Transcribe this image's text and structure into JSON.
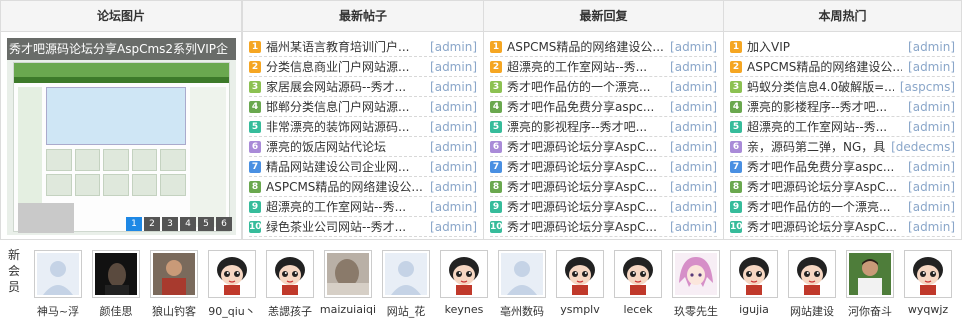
{
  "panels": {
    "pics": {
      "title": "论坛图片"
    },
    "posts": {
      "title": "最新帖子"
    },
    "replies": {
      "title": "最新回复"
    },
    "hot": {
      "title": "本周热门"
    }
  },
  "slide": {
    "caption": "秀才吧源码论坛分享AspCms2系列VIP企",
    "pages": [
      "1",
      "2",
      "3",
      "4",
      "5",
      "6"
    ],
    "active_page": 1
  },
  "latest_posts": [
    {
      "num": "1",
      "title": "福州某语言教育培训门户...",
      "author": "[admin]"
    },
    {
      "num": "2",
      "title": "分类信息商业门户网站源...",
      "author": "[admin]"
    },
    {
      "num": "3",
      "title": "家居展会网站源码--秀才...",
      "author": "[admin]"
    },
    {
      "num": "4",
      "title": "邯郸分类信息门户网站源...",
      "author": "[admin]"
    },
    {
      "num": "5",
      "title": "非常漂亮的装饰网站源码...",
      "author": "[admin]"
    },
    {
      "num": "6",
      "title": "漂亮的饭店网站代论坛",
      "author": "[admin]"
    },
    {
      "num": "7",
      "title": "精品网站建设公司企业网...",
      "author": "[admin]"
    },
    {
      "num": "8",
      "title": "ASPCMS精品的网络建设公...",
      "author": "[admin]"
    },
    {
      "num": "9",
      "title": "超漂亮的工作室网站--秀...",
      "author": "[admin]"
    },
    {
      "num": "10",
      "title": "绿色茶业公司网站--秀才...",
      "author": "[admin]"
    }
  ],
  "latest_replies": [
    {
      "num": "1",
      "title": "ASPCMS精品的网络建设公...",
      "author": "[admin]"
    },
    {
      "num": "2",
      "title": "超漂亮的工作室网站--秀...",
      "author": "[admin]"
    },
    {
      "num": "3",
      "title": "秀才吧作品仿的一个漂亮...",
      "author": "[admin]"
    },
    {
      "num": "4",
      "title": "秀才吧作品免费分享aspc...",
      "author": "[admin]"
    },
    {
      "num": "5",
      "title": "漂亮的影视程序--秀才吧...",
      "author": "[admin]"
    },
    {
      "num": "6",
      "title": "秀才吧源码论坛分享AspC...",
      "author": "[admin]"
    },
    {
      "num": "7",
      "title": "秀才吧源码论坛分享AspC...",
      "author": "[admin]"
    },
    {
      "num": "8",
      "title": "秀才吧源码论坛分享AspC...",
      "author": "[admin]"
    },
    {
      "num": "9",
      "title": "秀才吧源码论坛分享AspC...",
      "author": "[admin]"
    },
    {
      "num": "10",
      "title": "秀才吧源码论坛分享AspC...",
      "author": "[admin]"
    }
  ],
  "weekly_hot": [
    {
      "num": "1",
      "title": "加入VIP",
      "author": "[admin]"
    },
    {
      "num": "2",
      "title": "ASPCMS精品的网络建设公...",
      "author": "[admin]"
    },
    {
      "num": "3",
      "title": "蚂蚁分类信息4.0破解版=...",
      "author": "[aspcms]"
    },
    {
      "num": "4",
      "title": "漂亮的影楼程序--秀才吧...",
      "author": "[admin]"
    },
    {
      "num": "5",
      "title": "超漂亮的工作室网站--秀...",
      "author": "[admin]"
    },
    {
      "num": "6",
      "title": "亲，源码第二弹，NG，具...",
      "author": "[dedecms]"
    },
    {
      "num": "7",
      "title": "秀才吧作品免费分享aspc...",
      "author": "[admin]"
    },
    {
      "num": "8",
      "title": "秀才吧源码论坛分享AspC...",
      "author": "[admin]"
    },
    {
      "num": "9",
      "title": "秀才吧作品仿的一个漂亮...",
      "author": "[admin]"
    },
    {
      "num": "10",
      "title": "秀才吧源码论坛分享AspC...",
      "author": "[admin]"
    }
  ],
  "members": {
    "label": "新会员",
    "list": [
      {
        "name": "神马~浮",
        "avatar": "default"
      },
      {
        "name": "颜佳思",
        "avatar": "dark-photo"
      },
      {
        "name": "狼山钓客",
        "avatar": "person-photo"
      },
      {
        "name": "90_qiu丶",
        "avatar": "cartoon"
      },
      {
        "name": "恙諰孩子",
        "avatar": "cartoon"
      },
      {
        "name": "maizuiaiqi",
        "avatar": "blur-photo"
      },
      {
        "name": "网站_花",
        "avatar": "default"
      },
      {
        "name": "keynes",
        "avatar": "cartoon"
      },
      {
        "name": "亳州数码",
        "avatar": "default"
      },
      {
        "name": "ysmplv",
        "avatar": "cartoon"
      },
      {
        "name": "lecek",
        "avatar": "cartoon"
      },
      {
        "name": "玖零先生",
        "avatar": "anime"
      },
      {
        "name": "igujia",
        "avatar": "cartoon"
      },
      {
        "name": "网站建设",
        "avatar": "cartoon"
      },
      {
        "name": "河你奋斗",
        "avatar": "sport-photo"
      },
      {
        "name": "wyqwjz",
        "avatar": "cartoon"
      }
    ]
  },
  "colors": {
    "border": "#dcdcdc",
    "header_bg": "#f5f5f5",
    "author": "#8aa6c9",
    "pager_active": "#1e88e5"
  }
}
